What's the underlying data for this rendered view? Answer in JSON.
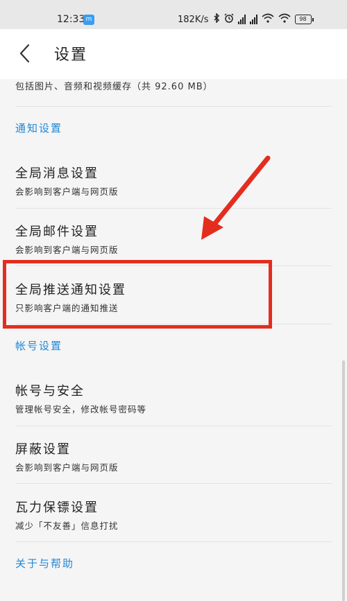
{
  "status_bar": {
    "time": "12:33",
    "badge": "m",
    "speed": "182K/s",
    "battery": "98"
  },
  "header": {
    "title": "设置"
  },
  "cache": {
    "description": "包括图片、音频和视频缓存（共 92.60 MB）"
  },
  "sections": {
    "notify": "通知设置",
    "account": "帐号设置",
    "about": "关于与帮助"
  },
  "items": {
    "global_message": {
      "title": "全局消息设置",
      "subtitle": "会影响到客户端与网页版"
    },
    "global_mail": {
      "title": "全局邮件设置",
      "subtitle": "会影响到客户端与网页版"
    },
    "global_push": {
      "title": "全局推送通知设置",
      "subtitle": "只影响客户端的通知推送"
    },
    "account_security": {
      "title": "帐号与安全",
      "subtitle": "管理帐号安全，修改帐号密码等"
    },
    "block": {
      "title": "屏蔽设置",
      "subtitle": "会影响到客户端与网页版"
    },
    "bodyguard": {
      "title": "瓦力保镖设置",
      "subtitle": "减少「不友善」信息打扰"
    }
  },
  "colors": {
    "accent": "#1e88d6",
    "annotation": "#e42d1e"
  }
}
